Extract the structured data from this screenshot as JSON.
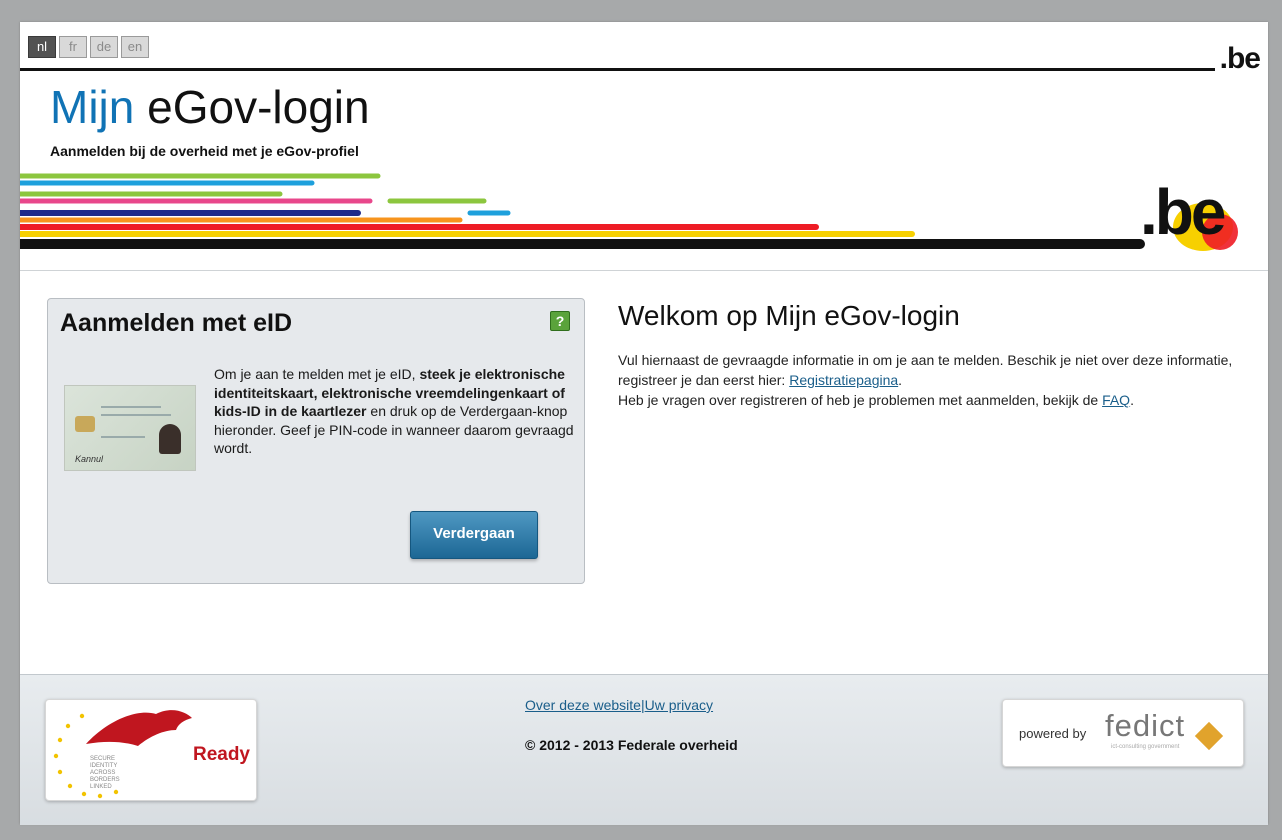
{
  "languages": [
    {
      "code": "nl",
      "active": true
    },
    {
      "code": "fr",
      "active": false
    },
    {
      "code": "de",
      "active": false
    },
    {
      "code": "en",
      "active": false
    }
  ],
  "header": {
    "title_prefix": "Mijn",
    "title_rest": " eGov-login",
    "subtitle": "Aanmelden bij de overheid met je eGov-profiel",
    "be_logo_small": ".be",
    "be_logo_big_dot": ".",
    "be_logo_big_b": "b",
    "be_logo_big_e": "e",
    "stripe_colors": [
      "#8cc63e",
      "#1ea0dc",
      "#e8478b",
      "#1f2a8a",
      "#f7941d",
      "#ee1c25",
      "#f7d000",
      "#111111"
    ]
  },
  "eid_panel": {
    "title": "Aanmelden met eID",
    "help_icon": "?",
    "text_1": "Om je aan te melden met je eID, ",
    "text_bold": "steek je elektronische identiteitskaart, elektronische vreemdelingenkaart of kids-ID in de kaartlezer",
    "text_2": " en druk op de Verdergaan-knop hieronder. Geef je PIN-code in wanneer daarom gevraagd wordt.",
    "button_label": "Verdergaan",
    "card_signature": "Kannul"
  },
  "welcome": {
    "title": "Welkom op Mijn eGov-login",
    "p1": "Vul hiernaast de gevraagde informatie in om je aan te melden. Beschik je niet over deze informatie, registreer je dan eerst hier: ",
    "link_register": "Registratiepagina",
    "p1_end": ".",
    "p2": "Heb je vragen over registreren of heb je problemen met aanmelden, bekijk de ",
    "link_faq": "FAQ",
    "p2_end": "."
  },
  "footer": {
    "link_about": "Over deze website",
    "separator": "|",
    "link_privacy": "Uw privacy",
    "copyright": "© 2012 - 2013 Federale overheid",
    "eagle_ready": "Ready",
    "eagle_words": [
      "SECURE",
      "IDENTITY",
      "ACROSS",
      "BORDERS",
      "LINKED"
    ],
    "powered_by": "powered by",
    "fedict": "fedict",
    "fedict_tagline": "ict-consulting government"
  }
}
